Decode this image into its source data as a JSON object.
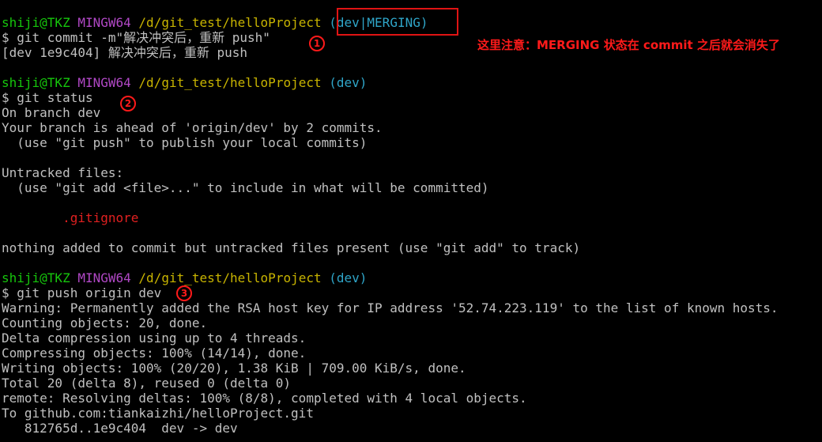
{
  "prompt": {
    "user": "shiji@TKZ",
    "msystem": "MINGW64",
    "path": "/d/git_test/helloProject",
    "branch_merging": "(dev|MERGING)",
    "branch": "(dev)"
  },
  "block1": {
    "command": "$ git commit -m\"解决冲突后，重新 push\"",
    "result": "[dev 1e9c404] 解决冲突后，重新 push"
  },
  "block2": {
    "command": "$ git status",
    "lines": [
      "On branch dev",
      "Your branch is ahead of 'origin/dev' by 2 commits.",
      "  (use \"git push\" to publish your local commits)",
      "",
      "Untracked files:",
      "  (use \"git add <file>...\" to include in what will be committed)",
      "",
      "        .gitignore",
      "",
      "nothing added to commit but untracked files present (use \"git add\" to track)"
    ]
  },
  "block3": {
    "command": "$ git push origin dev",
    "lines": [
      "Warning: Permanently added the RSA host key for IP address '52.74.223.119' to the list of known hosts.",
      "Counting objects: 20, done.",
      "Delta compression using up to 4 threads.",
      "Compressing objects: 100% (14/14), done.",
      "Writing objects: 100% (20/20), 1.38 KiB | 709.00 KiB/s, done.",
      "Total 20 (delta 8), reused 0 (delta 0)",
      "remote: Resolving deltas: 100% (8/8), completed with 4 local objects.",
      "To github.com:tiankaizhi/helloProject.git",
      "   812765d..1e9c404  dev -> dev"
    ]
  },
  "annotations": {
    "marker1": "1",
    "marker2": "2",
    "marker3": "3",
    "note": "这里注意：MERGING 状态在 commit 之后就会消失了"
  },
  "colors": {
    "background": "#000000",
    "user": "#16c60c",
    "msystem": "#b148c6",
    "path": "#c8b400",
    "branch": "#2fa5c8",
    "untracked_file": "#e02020",
    "annotation": "#ff1a1a"
  }
}
